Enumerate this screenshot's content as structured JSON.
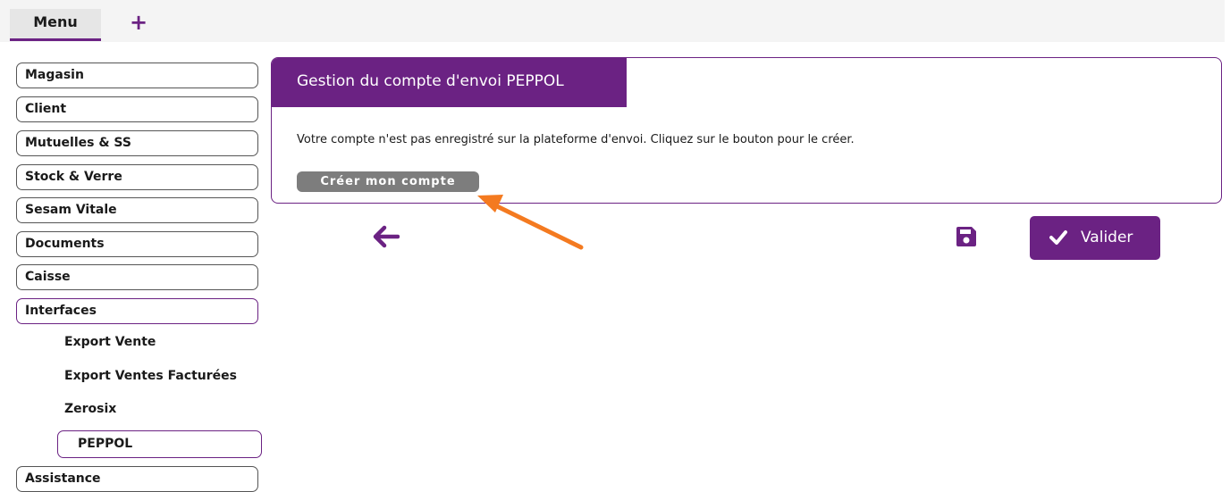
{
  "colors": {
    "brand": "#6b2283",
    "grey_button": "#7d7d7d",
    "annotation": "#f47a20"
  },
  "topbar": {
    "menu_label": "Menu",
    "add_label": "+"
  },
  "sidebar": {
    "items": [
      "Magasin",
      "Client",
      "Mutuelles & SS",
      "Stock & Verre",
      "Sesam Vitale",
      "Documents",
      "Caisse",
      "Interfaces"
    ],
    "subitems": [
      "Export Vente",
      "Export Ventes Facturées",
      "Zerosix",
      "PEPPOL"
    ],
    "last_item": "Assistance"
  },
  "panel": {
    "title": "Gestion du compte d'envoi PEPPOL",
    "message": "Votre compte n'est pas enregistré sur la plateforme d'envoi. Cliquez sur le bouton pour le créer.",
    "create_button": "Créer mon compte"
  },
  "actions": {
    "back_icon": "arrow-left-icon",
    "save_icon": "floppy-disk-icon",
    "validate_label": "Valider"
  }
}
